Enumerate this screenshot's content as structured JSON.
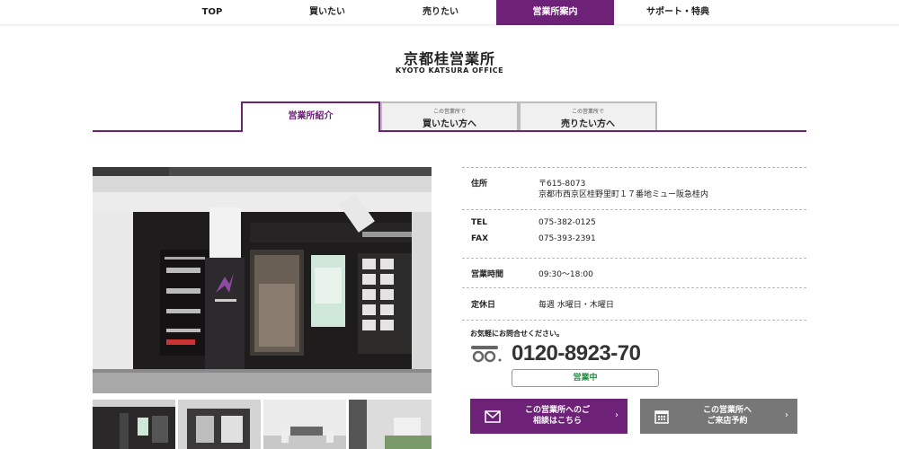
{
  "nav": {
    "items": [
      {
        "label": "TOP"
      },
      {
        "label": "買いたい"
      },
      {
        "label": "売りたい"
      },
      {
        "label": "営業所案内"
      },
      {
        "label": "サポート・特典"
      }
    ]
  },
  "header": {
    "title": "京都桂営業所",
    "subtitle": "KYOTO KATSURA OFFICE"
  },
  "tabs": {
    "intro": "営業所紹介",
    "buy_small": "この営業所で",
    "buy_big": "買いたい方へ",
    "sell_small": "この営業所で",
    "sell_big": "売りたい方へ"
  },
  "info": {
    "address_label": "住所",
    "postal": "〒615-8073",
    "address": "京都市西京区桂野里町１７番地ミュー阪急桂内",
    "tel_label": "TEL",
    "tel": "075-382-0125",
    "fax_label": "FAX",
    "fax": "075-393-2391",
    "hours_label": "営業時間",
    "hours": "09:30〜18:00",
    "holiday_label": "定休日",
    "holiday": "毎週 水曜日・木曜日"
  },
  "contact": {
    "note": "お気軽にお問合せください。",
    "phone": "0120-8923-70",
    "status": "営業中"
  },
  "buttons": {
    "consult_line1": "この営業所へのご",
    "consult_line2": "相談はこちら",
    "visit_line1": "この営業所へ",
    "visit_line2": "ご来店予約"
  },
  "colors": {
    "accent": "#6e2277",
    "open_green": "#1f8a3a",
    "visit_gray": "#777777"
  }
}
